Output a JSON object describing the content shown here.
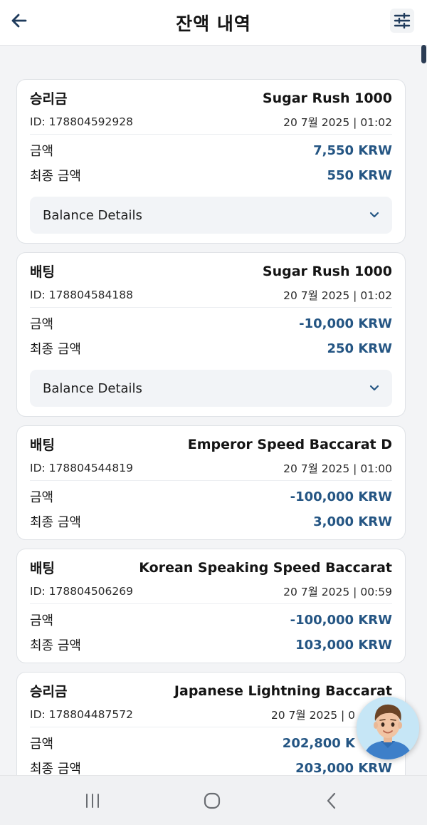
{
  "header": {
    "title": "잔액 내역",
    "back_icon": "arrow-left-icon",
    "filter_icon": "sliders-icon"
  },
  "labels": {
    "amount": "금액",
    "final_amount": "최종 금액",
    "balance_details": "Balance Details"
  },
  "transactions": [
    {
      "type": "승리금",
      "game": "Sugar Rush 1000",
      "id": "ID: 178804592928",
      "date": "20 7월 2025 | 01:02",
      "amount": "7,550 KRW",
      "final_amount": "550 KRW",
      "has_details": true
    },
    {
      "type": "배팅",
      "game": "Sugar Rush 1000",
      "id": "ID: 178804584188",
      "date": "20 7월 2025 | 01:02",
      "amount": "-10,000 KRW",
      "final_amount": "250 KRW",
      "has_details": true
    },
    {
      "type": "배팅",
      "game": "Emperor Speed Baccarat D",
      "id": "ID: 178804544819",
      "date": "20 7월 2025 | 01:00",
      "amount": "-100,000 KRW",
      "final_amount": "3,000 KRW",
      "has_details": false
    },
    {
      "type": "배팅",
      "game": "Korean Speaking Speed Baccarat",
      "id": "ID: 178804506269",
      "date": "20 7월 2025 | 00:59",
      "amount": "-100,000 KRW",
      "final_amount": "103,000 KRW",
      "has_details": false
    },
    {
      "type": "승리금",
      "game": "Japanese Lightning Baccarat",
      "id": "ID: 178804487572",
      "date": "20 7월 2025 | 0",
      "amount": "202,800 K",
      "final_amount": "203,000 KRW",
      "has_details": false
    }
  ],
  "colors": {
    "value_blue": "#245583",
    "header_bg": "#ffffff",
    "page_bg": "#f3f4f6",
    "card_border": "#dfe2e6"
  },
  "navbar": {
    "recents_icon": "recents-icon",
    "home_icon": "home-icon",
    "back_icon": "nav-back-icon"
  },
  "avatar_icon": "support-avatar-icon"
}
